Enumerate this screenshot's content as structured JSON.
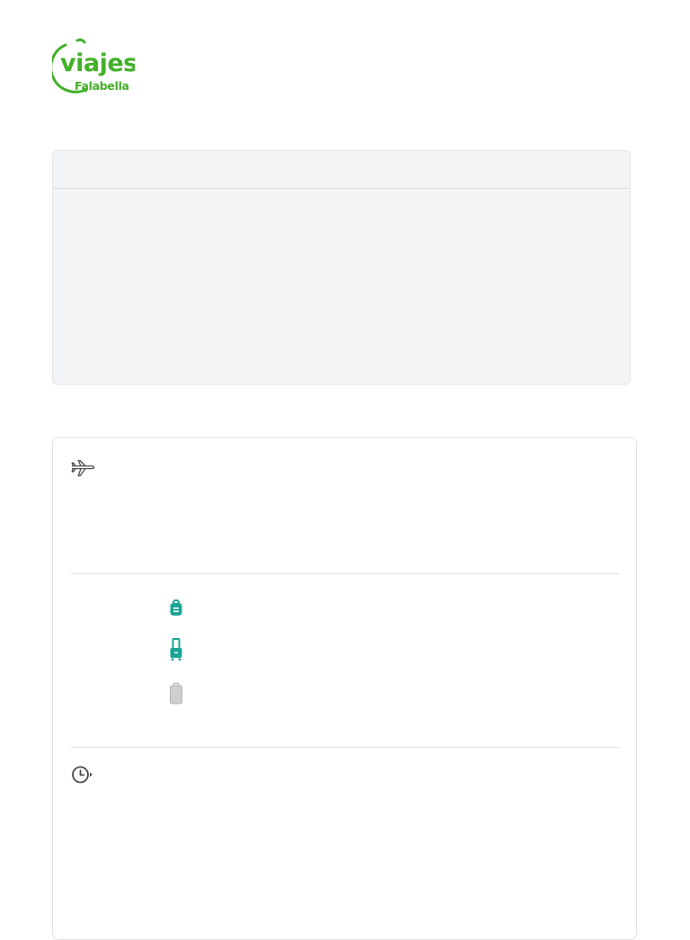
{
  "brand": {
    "logo_text": "viajes",
    "logo_subtext": "Falabella",
    "accent_color": "#43b02a"
  },
  "flight_card": {
    "header_icon": "plane-icon",
    "schedule_icon": "clock-icon",
    "baggage": [
      {
        "icon": "backpack-icon",
        "color": "#1aa596",
        "included": true
      },
      {
        "icon": "carry-on-suitcase-icon",
        "color": "#1aa596",
        "included": true
      },
      {
        "icon": "checked-bag-icon",
        "color": "#bdbdbd",
        "included": false
      }
    ]
  },
  "colors": {
    "included_baggage": "#1aa596",
    "excluded_baggage": "#bdbdbd",
    "panel_background": "#f3f4f6"
  }
}
